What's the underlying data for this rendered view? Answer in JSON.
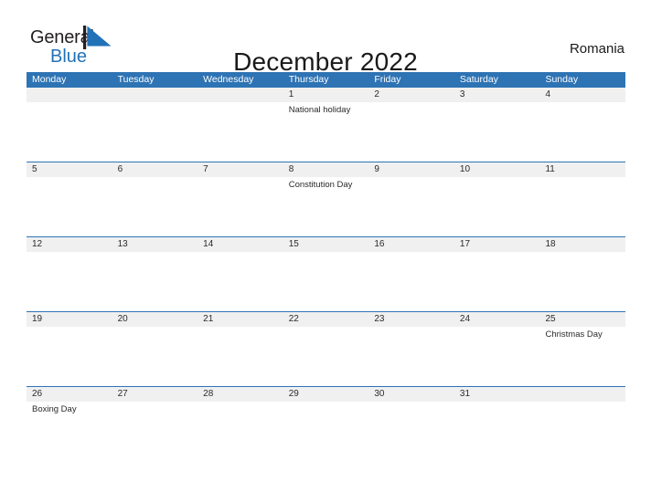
{
  "brand": {
    "line1": "General",
    "line2": "Blue",
    "flag_color": "#2272b8",
    "text_color": "#231f20"
  },
  "header": {
    "title": "December 2022",
    "region": "Romania"
  },
  "theme": {
    "header_blue": "#2e73b4",
    "band_gray": "#f0f0f0",
    "text_dark": "#2a2a2a"
  },
  "calendar": {
    "weekdays": [
      "Monday",
      "Tuesday",
      "Wednesday",
      "Thursday",
      "Friday",
      "Saturday",
      "Sunday"
    ],
    "weeks": [
      [
        {
          "day": "",
          "event": ""
        },
        {
          "day": "",
          "event": ""
        },
        {
          "day": "",
          "event": ""
        },
        {
          "day": "1",
          "event": "National holiday"
        },
        {
          "day": "2",
          "event": ""
        },
        {
          "day": "3",
          "event": ""
        },
        {
          "day": "4",
          "event": ""
        }
      ],
      [
        {
          "day": "5",
          "event": ""
        },
        {
          "day": "6",
          "event": ""
        },
        {
          "day": "7",
          "event": ""
        },
        {
          "day": "8",
          "event": "Constitution Day"
        },
        {
          "day": "9",
          "event": ""
        },
        {
          "day": "10",
          "event": ""
        },
        {
          "day": "11",
          "event": ""
        }
      ],
      [
        {
          "day": "12",
          "event": ""
        },
        {
          "day": "13",
          "event": ""
        },
        {
          "day": "14",
          "event": ""
        },
        {
          "day": "15",
          "event": ""
        },
        {
          "day": "16",
          "event": ""
        },
        {
          "day": "17",
          "event": ""
        },
        {
          "day": "18",
          "event": ""
        }
      ],
      [
        {
          "day": "19",
          "event": ""
        },
        {
          "day": "20",
          "event": ""
        },
        {
          "day": "21",
          "event": ""
        },
        {
          "day": "22",
          "event": ""
        },
        {
          "day": "23",
          "event": ""
        },
        {
          "day": "24",
          "event": ""
        },
        {
          "day": "25",
          "event": "Christmas Day"
        }
      ],
      [
        {
          "day": "26",
          "event": "Boxing Day"
        },
        {
          "day": "27",
          "event": ""
        },
        {
          "day": "28",
          "event": ""
        },
        {
          "day": "29",
          "event": ""
        },
        {
          "day": "30",
          "event": ""
        },
        {
          "day": "31",
          "event": ""
        },
        {
          "day": "",
          "event": ""
        }
      ]
    ]
  }
}
